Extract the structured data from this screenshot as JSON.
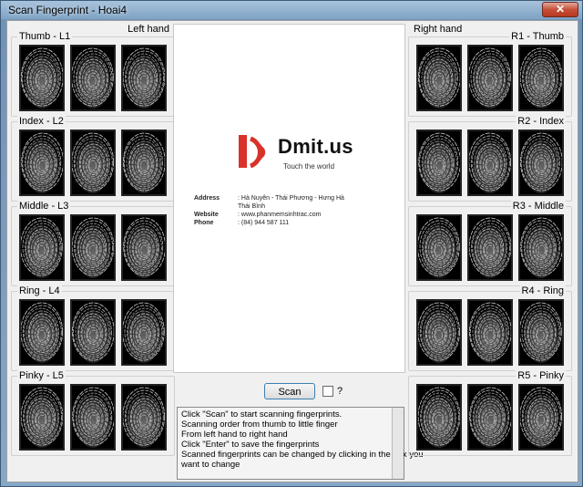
{
  "window": {
    "title": "Scan Fingerprint - Hoai4",
    "close_glyph": "✕"
  },
  "left_hand": {
    "caption": "Left hand",
    "fingers": [
      {
        "label": "Thumb - L1"
      },
      {
        "label": "Index - L2"
      },
      {
        "label": "Middle - L3"
      },
      {
        "label": "Ring - L4"
      },
      {
        "label": "Pinky - L5"
      }
    ]
  },
  "right_hand": {
    "caption": "Right hand",
    "fingers": [
      {
        "label": "R1 - Thumb"
      },
      {
        "label": "R2 - Index"
      },
      {
        "label": "R3 - Middle"
      },
      {
        "label": "R4 - Ring"
      },
      {
        "label": "R5 - Pinky"
      }
    ]
  },
  "logo": {
    "brand": "Dmit.us",
    "tagline": "Touch the world",
    "accent_color": "#d8322a",
    "address_label": "Address",
    "address_value": ": Hà Nuyên - Thái Phương - Hưng Hà",
    "address_value_2": "Thái Bình",
    "website_label": "Website",
    "website_value": ": www.phanmemsinhtrac.com",
    "phone_label": "Phone",
    "phone_value": ": (84) 944 587 111"
  },
  "controls": {
    "scan_label": "Scan",
    "help_label": "?"
  },
  "instructions": [
    "Click \"Scan\" to start scanning fingerprints.",
    "Scanning order from thumb to little finger",
    "From left hand to right hand",
    "Click \"Enter\" to save the fingerprints",
    "Scanned fingerprints can be changed by clicking in the box you",
    "want to change"
  ]
}
